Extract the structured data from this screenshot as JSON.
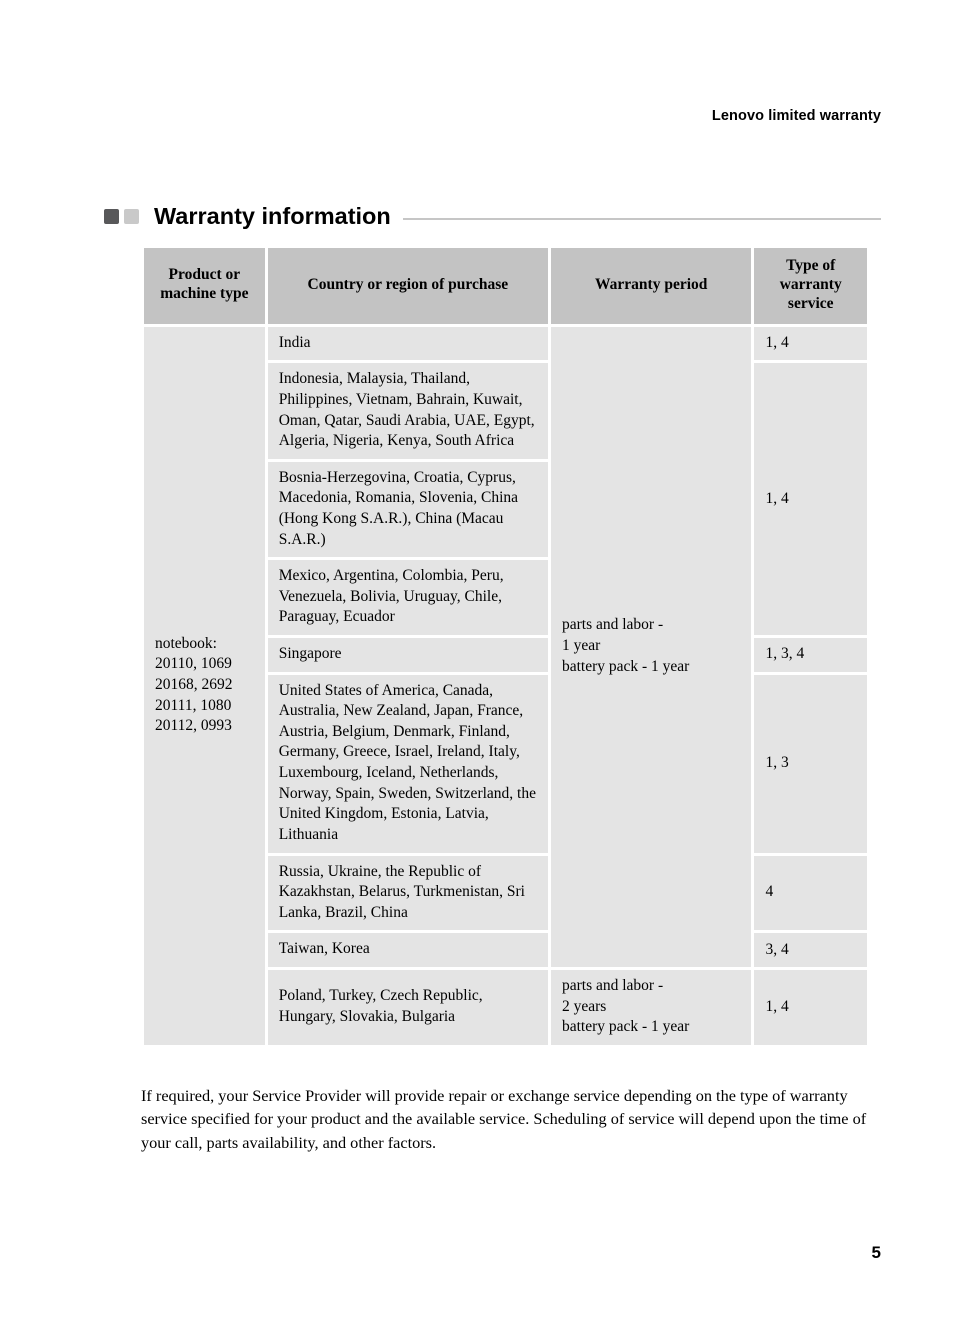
{
  "header": {
    "running_title": "Lenovo limited warranty"
  },
  "section": {
    "title": "Warranty information",
    "bullet_dark_color": "#58585a",
    "bullet_light_color": "#c9c9c9",
    "rule_color": "#c6c6c6"
  },
  "table": {
    "header_bg": "#c3c3c3",
    "cell_bg": "#e4e4e4",
    "columns": [
      "Product or\nmachine type",
      "Country or region of purchase",
      "Warranty period",
      "Type of\nwarranty\nservice"
    ],
    "headers": {
      "product_line1": "Product or",
      "product_line2": "machine type",
      "country": "Country or region of purchase",
      "period": "Warranty period",
      "type_line1": "Type of",
      "type_line2": "warranty",
      "type_line3": "service"
    },
    "product": {
      "label": "notebook:",
      "line2": "20110, 1069",
      "line3": "20168, 2692",
      "line4": "20111, 1080",
      "line5": "20112, 0993"
    },
    "rows": [
      {
        "country": "India",
        "service": "1, 4"
      },
      {
        "country": "Indonesia, Malaysia, Thailand, Philippines, Vietnam, Bahrain, Kuwait, Oman, Qatar, Saudi Arabia, UAE, Egypt, Algeria, Nigeria, Kenya, South Africa",
        "service": "1, 4"
      },
      {
        "country": "Bosnia-Herzegovina, Croatia, Cyprus, Macedonia, Romania, Slovenia, China (Hong Kong S.A.R.), China (Macau S.A.R.)",
        "service": ""
      },
      {
        "country": "Mexico, Argentina, Colombia, Peru, Venezuela, Bolivia, Uruguay, Chile, Paraguay, Ecuador",
        "service": ""
      },
      {
        "country": "Singapore",
        "service": "1, 3, 4"
      },
      {
        "country": "United States of America, Canada, Australia, New Zealand, Japan, France, Austria, Belgium, Denmark, Finland, Germany, Greece, Israel, Ireland, Italy, Luxembourg, Iceland, Netherlands, Norway, Spain, Sweden, Switzerland, the United Kingdom, Estonia, Latvia, Lithuania",
        "service": "1, 3"
      },
      {
        "country": "Russia, Ukraine, the Republic of Kazakhstan, Belarus, Turkmenistan, Sri Lanka, Brazil, China",
        "service": "4"
      },
      {
        "country": "Taiwan, Korea",
        "service": "3, 4"
      },
      {
        "country": "Poland, Turkey, Czech Republic, Hungary, Slovakia, Bulgaria",
        "service": "1, 4"
      }
    ],
    "period_main": {
      "line1": "parts and labor -",
      "line2": "1 year",
      "line3": "battery pack - 1 year"
    },
    "period_last": {
      "line1": "parts and labor -",
      "line2": "2 years",
      "line3": "battery pack - 1 year"
    }
  },
  "footer": {
    "paragraph": "If required, your Service Provider will provide repair or exchange service depending on the type of warranty service specified for your product and the available service. Scheduling of service will depend upon the time of your call, parts availability, and other factors.",
    "page_number": "5"
  }
}
